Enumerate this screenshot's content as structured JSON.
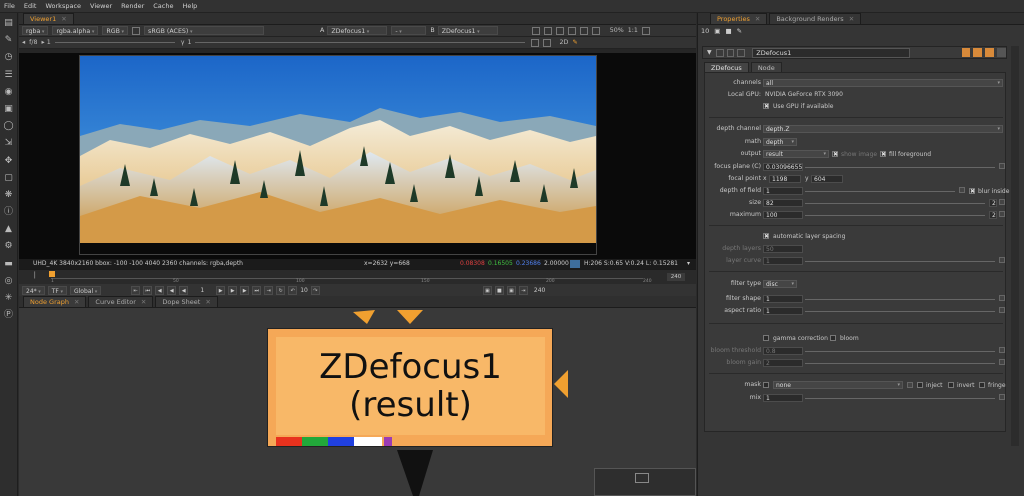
{
  "menubar": [
    "File",
    "Edit",
    "Workspace",
    "Viewer",
    "Render",
    "Cache",
    "Help"
  ],
  "toolbar_icons": [
    "image-icon",
    "draw-icon",
    "time-icon",
    "channel-icon",
    "color-icon",
    "filter-icon",
    "keyer-icon",
    "merge-icon",
    "transform-icon",
    "3d-icon",
    "views-icon",
    "metadata-icon",
    "deep-icon",
    "toolsets-icon",
    "other-icon",
    "furnace-icon",
    "particles-icon",
    "nuke-icon"
  ],
  "viewer": {
    "tab_label": "Viewer1",
    "layer": "rgba",
    "alpha": "rgba.alpha",
    "colorspace_mode": "RGB",
    "lut": "sRGB (ACES)",
    "input_a_label": "A",
    "input_a": "ZDefocus1",
    "input_a_op": "-",
    "input_b_label": "B",
    "input_b": "ZDefocus1",
    "zoom": "50%",
    "ratio": "1:1",
    "mode": "2D",
    "fstop": "f/8",
    "gain": "1",
    "gamma": "1",
    "info_format": "UHD_4K 3840x2160  bbox: -100 -100 4040 2360 channels: rgba,depth",
    "info_xy": "x=2632 y=668",
    "info_r": "0.08308",
    "info_g": "0.16505",
    "info_b": "0.23686",
    "info_a": "2.00000",
    "info_hsvl": "H:206 S:0.65 V:0.24  L: 0.15281",
    "timeline_ticks": [
      "1",
      "50",
      "100",
      "150",
      "200",
      "240"
    ],
    "timeline_end": "240",
    "fps": "24*",
    "tf": "TF",
    "range": "Global",
    "frame": "1",
    "step": "10",
    "end_frame": "240"
  },
  "node_graph": {
    "tabs": [
      "Node Graph",
      "Curve Editor",
      "Dope Sheet"
    ],
    "node_name": "ZDefocus1",
    "node_sub": "(result)",
    "node_colors": [
      "#e8321e",
      "#22a83a",
      "#2040e0",
      "#ffffff",
      "#ffffff",
      "#9c3cb4"
    ]
  },
  "properties": {
    "tabs": [
      "Properties",
      "Background Renders"
    ],
    "max_panels": "10",
    "node_name": "ZDefocus1",
    "node_tabs": [
      "ZDefocus",
      "Node"
    ],
    "channels_label": "channels",
    "channels_value": "all",
    "gpu_label": "Local GPU:",
    "gpu_value": "NVIDIA GeForce RTX 3090",
    "use_gpu": "Use GPU if available",
    "depth_channel_label": "depth channel",
    "depth_channel_value": "depth.Z",
    "math_label": "math",
    "math_value": "depth",
    "output_label": "output",
    "output_value": "result",
    "show_image": "show image",
    "fill_foreground": "fill foreground",
    "focus_plane_label": "focus plane (C)",
    "focus_plane_value": "0.03096655",
    "focal_point_label": "focal point",
    "focal_x_label": "x",
    "focal_x": "1198",
    "focal_y_label": "y",
    "focal_y": "604",
    "dof_label": "depth of field",
    "dof_value": "1",
    "blur_inside": "blur inside",
    "size_label": "size",
    "size_value": "82",
    "maximum_label": "maximum",
    "maximum_value": "100",
    "auto_layer": "automatic layer spacing",
    "depth_layers_label": "depth layers",
    "depth_layers_value": "50",
    "layer_curve_label": "layer curve",
    "layer_curve_value": "1",
    "filter_type_label": "filter type",
    "filter_type_value": "disc",
    "filter_shape_label": "filter shape",
    "filter_shape_value": "1",
    "aspect_ratio_label": "aspect ratio",
    "aspect_ratio_value": "1",
    "gamma_correction": "gamma correction",
    "bloom": "bloom",
    "bloom_threshold_label": "bloom threshold",
    "bloom_threshold_value": "0.8",
    "bloom_gain_label": "bloom gain",
    "bloom_gain_value": "2",
    "mask_label": "mask",
    "mask_value": "none",
    "inject": "inject",
    "invert": "invert",
    "fringe": "fringe",
    "mix_label": "mix",
    "mix_value": "1",
    "side_values": [
      "2",
      "2"
    ]
  }
}
